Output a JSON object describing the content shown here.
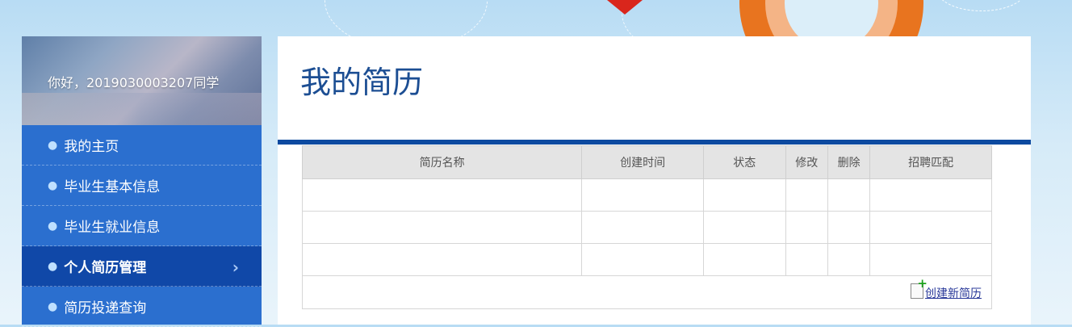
{
  "sidebar": {
    "greeting": "你好，2019030003207同学",
    "items": [
      {
        "label": "我的主页"
      },
      {
        "label": "毕业生基本信息"
      },
      {
        "label": "毕业生就业信息"
      },
      {
        "label": "个人简历管理",
        "active": true
      },
      {
        "label": "简历投递查询"
      }
    ]
  },
  "main": {
    "title": "我的简历",
    "table": {
      "headers": [
        "简历名称",
        "创建时间",
        "状态",
        "修改",
        "删除",
        "招聘匹配"
      ],
      "rows": [
        [
          "",
          "",
          "",
          "",
          "",
          ""
        ],
        [
          "",
          "",
          "",
          "",
          "",
          ""
        ],
        [
          "",
          "",
          "",
          "",
          "",
          ""
        ]
      ]
    },
    "create_link": "创建新简历"
  },
  "colors": {
    "sidebar_bg": "#2b6fcf",
    "sidebar_active": "#1048a8",
    "title_color": "#1c4e93",
    "title_bar": "#0d4aa0"
  },
  "icons": {
    "bullet": "bullet-dot-icon",
    "active_arrow": "chevron-right-icon",
    "create": "new-document-icon"
  }
}
